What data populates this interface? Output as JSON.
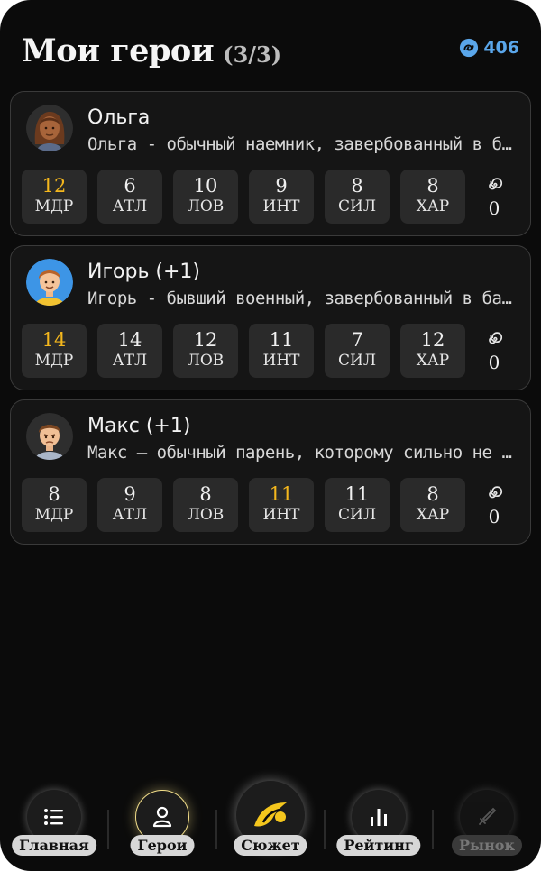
{
  "header": {
    "title": "Мои герои",
    "count": "(3/3)",
    "currency": "406",
    "currency_icon": "swirl-coin-icon"
  },
  "heroes": [
    {
      "name": "Ольга",
      "description": "Ольга - обычный наемник, завербованный в банду",
      "stats": [
        {
          "value": "12",
          "label": "МДР",
          "highlight": true
        },
        {
          "value": "6",
          "label": "АТЛ",
          "highlight": false
        },
        {
          "value": "10",
          "label": "ЛОВ",
          "highlight": false
        },
        {
          "value": "9",
          "label": "ИНТ",
          "highlight": false
        },
        {
          "value": "8",
          "label": "СИЛ",
          "highlight": false
        },
        {
          "value": "8",
          "label": "ХАР",
          "highlight": false
        }
      ],
      "extra": "0"
    },
    {
      "name": "Игорь (+1)",
      "description": "Игорь - бывший военный, завербованный в банду",
      "stats": [
        {
          "value": "14",
          "label": "МДР",
          "highlight": true
        },
        {
          "value": "14",
          "label": "АТЛ",
          "highlight": false
        },
        {
          "value": "12",
          "label": "ЛОВ",
          "highlight": false
        },
        {
          "value": "11",
          "label": "ИНТ",
          "highlight": false
        },
        {
          "value": "7",
          "label": "СИЛ",
          "highlight": false
        },
        {
          "value": "12",
          "label": "ХАР",
          "highlight": false
        }
      ],
      "extra": "0"
    },
    {
      "name": "Макс (+1)",
      "description": "Макс — обычный парень, которому сильно не повезло",
      "stats": [
        {
          "value": "8",
          "label": "МДР",
          "highlight": false
        },
        {
          "value": "9",
          "label": "АТЛ",
          "highlight": false
        },
        {
          "value": "8",
          "label": "ЛОВ",
          "highlight": false
        },
        {
          "value": "11",
          "label": "ИНТ",
          "highlight": true
        },
        {
          "value": "11",
          "label": "СИЛ",
          "highlight": false
        },
        {
          "value": "8",
          "label": "ХАР",
          "highlight": false
        }
      ],
      "extra": "0"
    }
  ],
  "colors": {
    "background": "#0b0b0b",
    "highlight": "#f4b71d",
    "currency": "#5aa6ea",
    "card_border": "#3a3a3a"
  },
  "nav": [
    {
      "label": "Главная",
      "icon": "list-icon",
      "state": "normal"
    },
    {
      "label": "Герои",
      "icon": "person-icon",
      "state": "active"
    },
    {
      "label": "Сюжет",
      "icon": "story-logo-icon",
      "state": "featured"
    },
    {
      "label": "Рейтинг",
      "icon": "bar-chart-icon",
      "state": "normal"
    },
    {
      "label": "Рынок",
      "icon": "sword-icon",
      "state": "disabled"
    }
  ]
}
